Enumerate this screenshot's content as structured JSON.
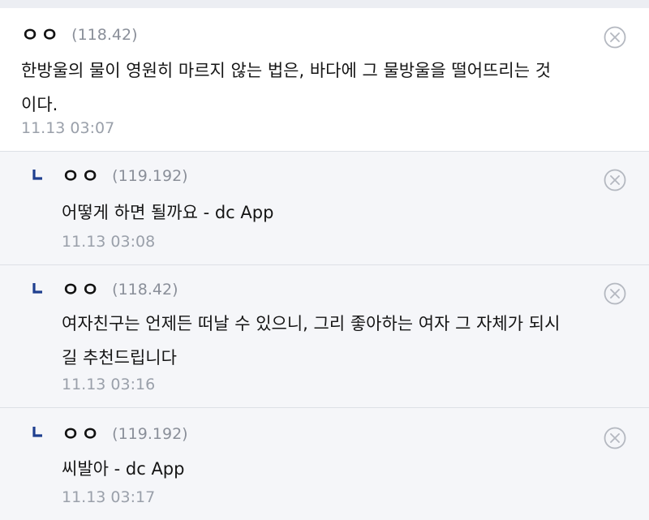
{
  "comments": [
    {
      "author": "ㅇㅇ",
      "ip": "(118.42)",
      "text_lines": [
        "한방울의 물이 영원히 마르지 않는 법은, 바다에 그 물방울을 떨어뜨리는 것",
        "이다."
      ],
      "timestamp": "11.13 03:07",
      "is_reply": false
    },
    {
      "author": "ㅇㅇ",
      "ip": "(119.192)",
      "text_lines": [
        "어떻게 하면 될까요 - dc App"
      ],
      "timestamp": "11.13 03:08",
      "is_reply": true
    },
    {
      "author": "ㅇㅇ",
      "ip": "(118.42)",
      "text_lines": [
        "여자친구는 언제든 떠날 수 있으니, 그리 좋아하는 여자 그 자체가 되시",
        "길 추천드립니다"
      ],
      "timestamp": "11.13 03:16",
      "is_reply": true
    },
    {
      "author": "ㅇㅇ",
      "ip": "(119.192)",
      "text_lines": [
        "씨발아 - dc App"
      ],
      "timestamp": "11.13 03:17",
      "is_reply": true
    }
  ],
  "icons": {
    "delete": "close-circle-icon",
    "reply": "reply-arrow-icon"
  },
  "colors": {
    "reply_background": "#f5f6f9",
    "ip_gray": "#8a8f99",
    "timestamp_gray": "#9aa0aa",
    "divider": "#dde0e6"
  }
}
